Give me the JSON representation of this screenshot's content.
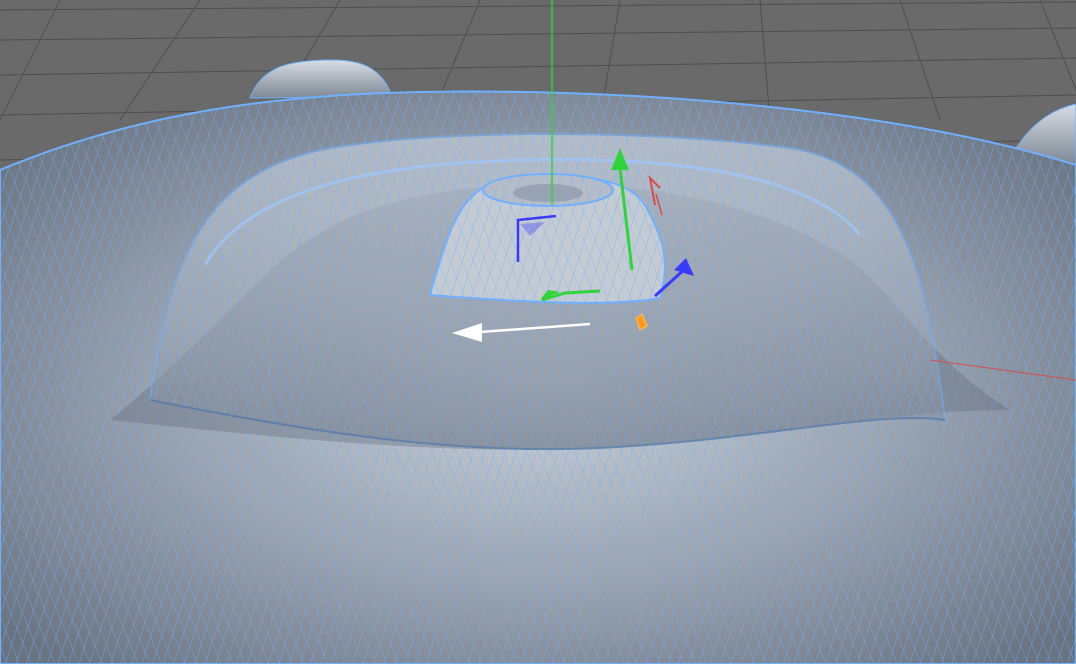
{
  "viewport": {
    "title": "",
    "colors": {
      "background": "#6b6b6b",
      "grid": "#4f4f4f",
      "mesh_fill_light": "#b9c0c8",
      "mesh_fill_dark": "#6e7784",
      "wire": "#6fb0ff",
      "axis_x": "#d94a4a",
      "axis_y": "#2fd33a",
      "axis_z": "#3a3aff",
      "move_arrow": "#ffffff",
      "handle": "#ff9a1a"
    },
    "icons": {
      "gizmo": "move-gizmo-icon",
      "arrow": "drag-direction-icon",
      "handle": "axis-handle-icon"
    }
  }
}
